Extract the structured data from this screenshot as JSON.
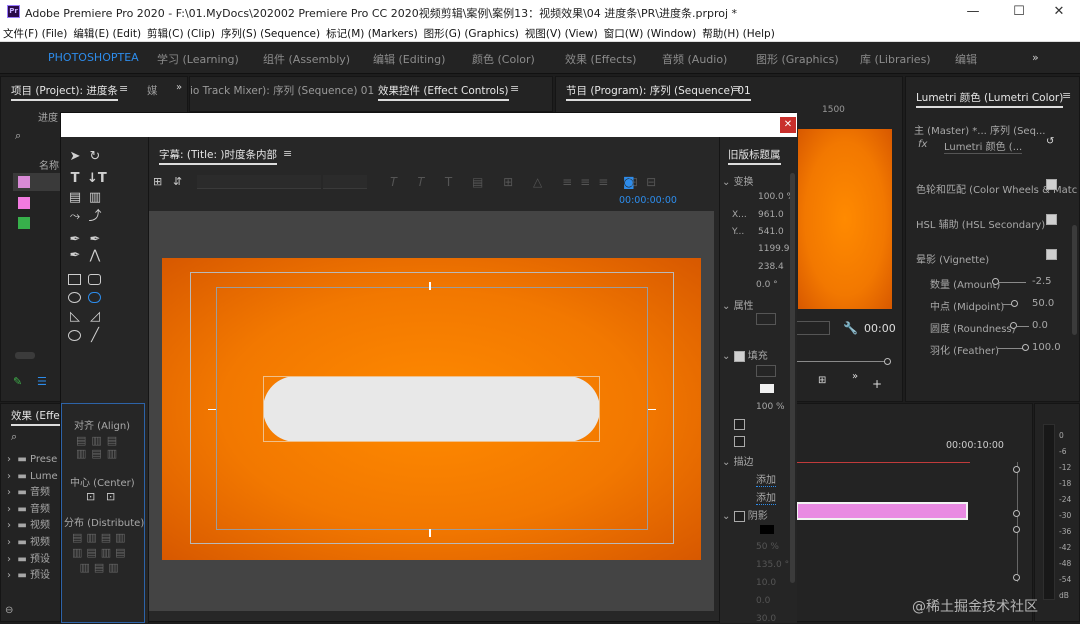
{
  "window": {
    "title": "Adobe Premiere Pro 2020 - F:\\01.MyDocs\\202002 Premiere Pro CC 2020视频剪辑\\案例\\案例13：视频效果\\04 进度条\\PR\\进度条.prproj *"
  },
  "menu": [
    "文件(F) (File)",
    "编辑(E) (Edit)",
    "剪辑(C) (Clip)",
    "序列(S) (Sequence)",
    "标记(M) (Markers)",
    "图形(G) (Graphics)",
    "视图(V) (View)",
    "窗口(W) (Window)",
    "帮助(H) (Help)"
  ],
  "workspaces": [
    {
      "label": "PHOTOSHOPTEA",
      "active": true
    },
    {
      "label": "学习 (Learning)"
    },
    {
      "label": "组件 (Assembly)"
    },
    {
      "label": "编辑 (Editing)"
    },
    {
      "label": "颜色 (Color)"
    },
    {
      "label": "效果 (Effects)"
    },
    {
      "label": "音频 (Audio)"
    },
    {
      "label": "图形 (Graphics)"
    },
    {
      "label": "库 (Libraries)"
    },
    {
      "label": "编辑"
    }
  ],
  "project_panel": {
    "tab": "项目 (Project): 进度条",
    "tab2": "媒",
    "bin_label": "进度",
    "name_col": "名称",
    "rows": [
      {
        "color": "#d98ad6"
      },
      {
        "color": "#f27ae0"
      },
      {
        "color": "#37b04b"
      }
    ]
  },
  "effects_panel": {
    "tab": "效果 (Effec",
    "items": [
      "Prese",
      "Lume",
      "音频",
      "音频",
      "视频",
      "视频",
      "预设",
      "预设"
    ]
  },
  "source_tabs": {
    "audio_mixer": "io Track Mixer): 序列 (Sequence) 01",
    "effect_controls": "效果控件 (Effect Controls)"
  },
  "program": {
    "tab": "节目 (Program): 序列 (Sequence) 01",
    "ruler": "1500",
    "timecode": "00:00"
  },
  "timeline": {
    "timecode": "00:00:10:00"
  },
  "audio_meter": {
    "ticks": [
      "0",
      "-6",
      "-12",
      "-18",
      "-24",
      "-30",
      "-36",
      "-42",
      "-48",
      "-54",
      "dB"
    ]
  },
  "lumetri": {
    "tab": "Lumetri 颜色 (Lumetri Color)",
    "master": "主 (Master) *...",
    "sequence": "序列 (Seq...",
    "fx_name": "Lumetri 颜色 (...",
    "fx_label": "fx",
    "sections": [
      {
        "label": "色轮和匹配 (Color Wheels & Matc",
        "checked": true
      },
      {
        "label": "HSL 辅助 (HSL Secondary)",
        "checked": true
      },
      {
        "label": "晕影 (Vignette)",
        "checked": true
      }
    ],
    "params": [
      {
        "label": "数量 (Amount)",
        "value": "-2.5"
      },
      {
        "label": "中点 (Midpoint)",
        "value": "50.0"
      },
      {
        "label": "圆度 (Roundness)",
        "value": "0.0"
      },
      {
        "label": "羽化 (Feather)",
        "value": "100.0"
      }
    ]
  },
  "titler": {
    "title_tab": "字幕: (Title: )时度条内部",
    "timecode": "00:00:00:00",
    "align": {
      "label": "对齐 (Align)"
    },
    "center": {
      "label": "中心 (Center)"
    },
    "distribute": {
      "label": "分布 (Distribute)"
    },
    "props_tab": "旧版标题属",
    "transform": {
      "label": "变换",
      "values": [
        {
          "k": "",
          "v": "100.0 %"
        },
        {
          "k": "X...",
          "v": "961.0"
        },
        {
          "k": "Y...",
          "v": "541.0"
        },
        {
          "k": "",
          "v": "1199.9"
        },
        {
          "k": "",
          "v": "238.4"
        },
        {
          "k": "",
          "v": "0.0 °"
        }
      ]
    },
    "properties": {
      "label": "属性"
    },
    "fill": {
      "label": "填充",
      "percent": "100 %"
    },
    "stroke": {
      "label": "描边",
      "add1": "添加",
      "add2": "添加"
    },
    "shadow": {
      "label": "阴影",
      "vals": [
        "50 %",
        "135.0 °",
        "10.0",
        "0.0",
        "30.0"
      ]
    }
  },
  "watermark": "@稀土掘金技术社区",
  "colors": {
    "accent": "#2d8ceb",
    "orange": "#f27800",
    "pink": "#e98ae2"
  }
}
